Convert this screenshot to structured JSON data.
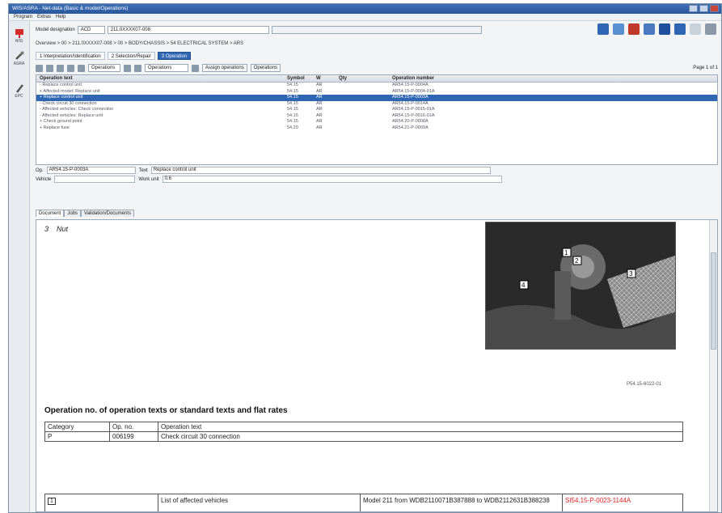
{
  "window": {
    "title": "WIS/ASRA - Net-data (Basic & model/Operations)"
  },
  "menu": [
    "Program",
    "Extras",
    "Help"
  ],
  "sidebar": [
    {
      "label": "WIS",
      "color": "#d12b2b"
    },
    {
      "label": "ASRA",
      "color": "#6d6d6d"
    },
    {
      "label": "EPC",
      "color": "#6d6d6d"
    }
  ],
  "model": {
    "label": "Model designation",
    "value": "ACD",
    "vin": "211.0XXXX07-008"
  },
  "breadcrumb": "Overview > 00 > 211.0XXXX07-008 > 00 > BODY/CHASSIS > 54 ELECTRICAL SYSTEM > ARS",
  "tabs": [
    {
      "label": "1 Interpretation/Identification",
      "active": false
    },
    {
      "label": "2 Selection/Repair",
      "active": false
    },
    {
      "label": "3 Operation",
      "active": true
    }
  ],
  "toolbar": {
    "combo1": "Operations",
    "combo2": "Operations",
    "btn1": "Assign operations",
    "btn2": "Operations",
    "page": "Page 1 of 1"
  },
  "grid": {
    "headers": [
      "Operation text",
      "Symbol",
      "W",
      "Qty",
      "Operation number"
    ],
    "rows": [
      {
        "text": "- Replace control unit",
        "sym": "54.15",
        "w": "AR",
        "qty": "",
        "num": "AR54.15-P-0004A",
        "sel": false
      },
      {
        "text": "  + Affected model: Replace unit",
        "sym": "54.15",
        "w": "AR",
        "qty": "",
        "num": "AR54.15-P-0004-01A",
        "sel": false
      },
      {
        "text": "+ Replace control unit",
        "sym": "54.15",
        "w": "AR",
        "qty": "",
        "num": "AR54.15-P-0003A",
        "sel": true
      },
      {
        "text": "- Check circuit 30 connection",
        "sym": "54.15",
        "w": "AR",
        "qty": "",
        "num": "AR54.15-P-0014A",
        "sel": false
      },
      {
        "text": "  - Affected vehicles: Check connection",
        "sym": "54.15",
        "w": "AR",
        "qty": "",
        "num": "AR54.15-P-0015-01A",
        "sel": false
      },
      {
        "text": "  - Affected vehicles: Replace unit",
        "sym": "54.15",
        "w": "AR",
        "qty": "",
        "num": "AR54.15-P-0016-01A",
        "sel": false
      },
      {
        "text": "+ Check ground point",
        "sym": "54.15",
        "w": "AR",
        "qty": "",
        "num": "AR54.20-P-0008A",
        "sel": false
      },
      {
        "text": "+ Replace fuse",
        "sym": "54.20",
        "w": "AR",
        "qty": "",
        "num": "AR54.21-P-0009A",
        "sel": false
      }
    ]
  },
  "detail": {
    "op_label": "Op.",
    "op_value": "AR54.15-P-0003A",
    "text_label": "Text",
    "text_value": "Replace control unit",
    "vehicle_label": "Vehicle",
    "factor_label": "Work unit",
    "factor_value": "0.6"
  },
  "doc_tabs": [
    "Document",
    "Jobs",
    "Validation/Documents"
  ],
  "doc": {
    "step_number": "3",
    "step_text": "Nut",
    "figure_ref": "P54.15-6022-01",
    "photo_labels": [
      "1",
      "2",
      "3",
      "4"
    ],
    "ops_title": "Operation no. of operation texts or standard texts and flat rates",
    "ops_headers": [
      "Category",
      "Op. no.",
      "Operation text"
    ],
    "ops_rows": [
      [
        "P",
        "006199",
        "Check circuit 30 connection"
      ]
    ],
    "affected": {
      "box": "1",
      "label": "List of affected vehicles",
      "model_text": "Model 211 from WDB2110071B387888 to WDB2112631B388238",
      "link": "SI54.15-P-0023-1144A"
    }
  }
}
